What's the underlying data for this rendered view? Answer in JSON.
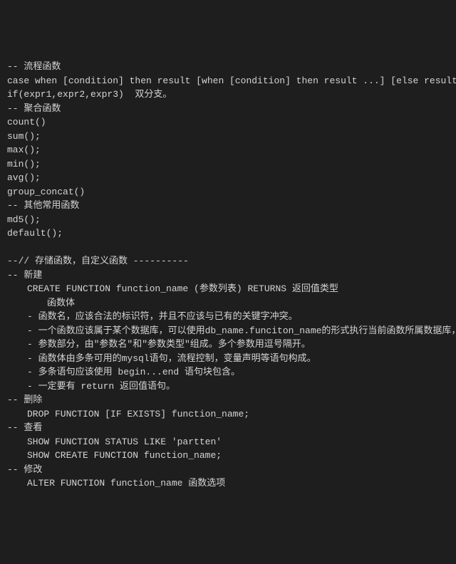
{
  "lines": [
    {
      "cls": "",
      "text": "-- 流程函数"
    },
    {
      "cls": "",
      "text": "case when [condition] then result [when [condition] then result ...] [else result] end   多"
    },
    {
      "cls": "",
      "text": "if(expr1,expr2,expr3)  双分支。"
    },
    {
      "cls": "",
      "text": "-- 聚合函数"
    },
    {
      "cls": "",
      "text": "count()"
    },
    {
      "cls": "",
      "text": "sum();"
    },
    {
      "cls": "",
      "text": "max();"
    },
    {
      "cls": "",
      "text": "min();"
    },
    {
      "cls": "",
      "text": "avg();"
    },
    {
      "cls": "",
      "text": "group_concat()"
    },
    {
      "cls": "",
      "text": "-- 其他常用函数"
    },
    {
      "cls": "",
      "text": "md5();"
    },
    {
      "cls": "",
      "text": "default();"
    },
    {
      "cls": "",
      "text": ""
    },
    {
      "cls": "",
      "text": "--// 存储函数，自定义函数 ----------"
    },
    {
      "cls": "",
      "text": "-- 新建"
    },
    {
      "cls": "indent1",
      "text": "CREATE FUNCTION function_name (参数列表) RETURNS 返回值类型"
    },
    {
      "cls": "indent2",
      "text": "函数体"
    },
    {
      "cls": "indent1",
      "text": "- 函数名，应该合法的标识符，并且不应该与已有的关键字冲突。"
    },
    {
      "cls": "indent1",
      "text": "- 一个函数应该属于某个数据库，可以使用db_name.funciton_name的形式执行当前函数所属数据库，否则"
    },
    {
      "cls": "indent1",
      "text": "- 参数部分，由\"参数名\"和\"参数类型\"组成。多个参数用逗号隔开。"
    },
    {
      "cls": "indent1",
      "text": "- 函数体由多条可用的mysql语句，流程控制，变量声明等语句构成。"
    },
    {
      "cls": "indent1",
      "text": "- 多条语句应该使用 begin...end 语句块包含。"
    },
    {
      "cls": "indent1",
      "text": "- 一定要有 return 返回值语句。"
    },
    {
      "cls": "",
      "text": "-- 删除"
    },
    {
      "cls": "indent1",
      "text": "DROP FUNCTION [IF EXISTS] function_name;"
    },
    {
      "cls": "",
      "text": "-- 查看"
    },
    {
      "cls": "indent1",
      "text": "SHOW FUNCTION STATUS LIKE 'partten'"
    },
    {
      "cls": "indent1",
      "text": "SHOW CREATE FUNCTION function_name;"
    },
    {
      "cls": "",
      "text": "-- 修改"
    },
    {
      "cls": "indent1",
      "text": "ALTER FUNCTION function_name 函数选项"
    }
  ]
}
